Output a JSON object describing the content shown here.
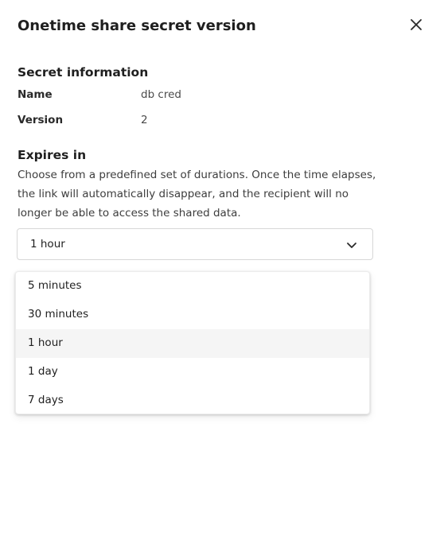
{
  "dialog": {
    "title": "Onetime share secret version",
    "close_icon": "close-icon"
  },
  "secret_info": {
    "heading": "Secret information",
    "name_label": "Name",
    "name_value": "db cred",
    "version_label": "Version",
    "version_value": "2"
  },
  "expires": {
    "heading": "Expires in",
    "description": "Choose from a predefined set of durations. Once the time elapses, the link will automatically disappear, and the recipient will no longer be able to access the shared data.",
    "selected_value": "1 hour",
    "chevron_icon": "chevron-down-icon",
    "options": [
      {
        "label": "5 minutes"
      },
      {
        "label": "30 minutes"
      },
      {
        "label": "1 hour",
        "selected": true
      },
      {
        "label": "1 day"
      },
      {
        "label": "7 days"
      }
    ]
  },
  "colors": {
    "text": "#1f1f1f",
    "border": "#d7d7d7",
    "selected_option_bg": "#f5f5f5"
  }
}
